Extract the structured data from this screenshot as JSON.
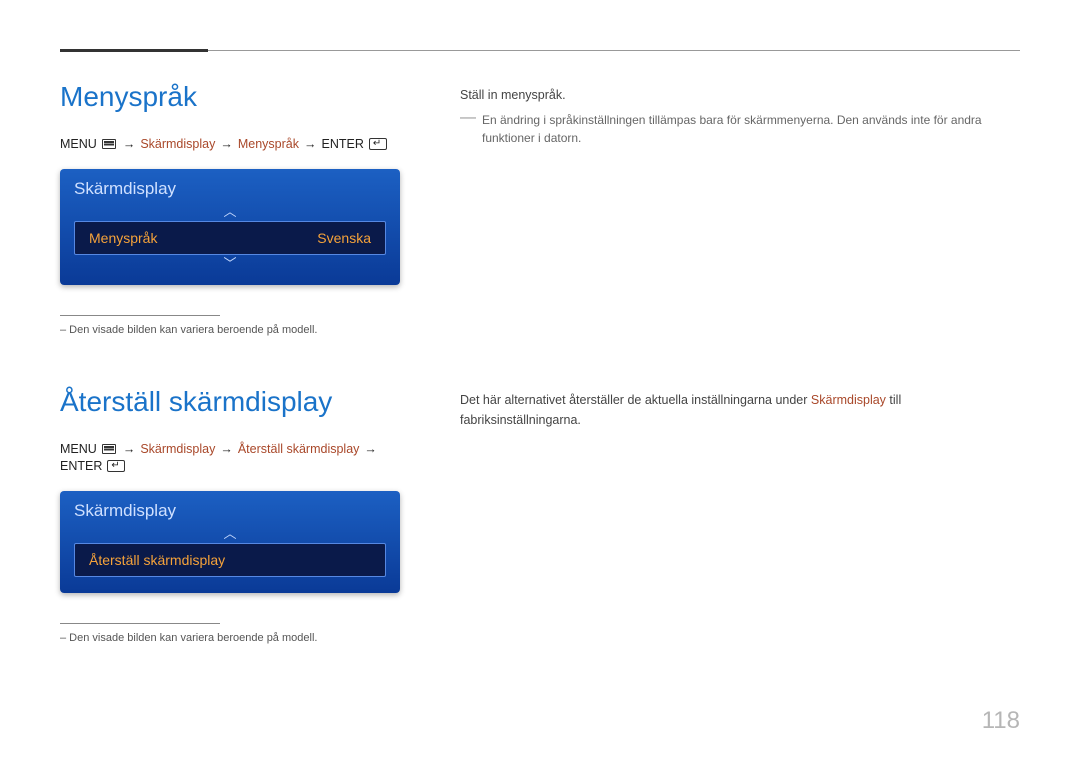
{
  "page_number": "118",
  "section1": {
    "title": "Menyspråk",
    "breadcrumb": {
      "menu": "MENU",
      "p1": "Skärmdisplay",
      "p2": "Menyspråk",
      "enter": "ENTER"
    },
    "menu": {
      "header": "Skärmdisplay",
      "item_label": "Menyspråk",
      "item_value": "Svenska"
    },
    "footnote": "– Den visade bilden kan variera beroende på modell.",
    "desc_intro": "Ställ in menyspråk.",
    "desc_note": "En ändring i språkinställningen tillämpas bara för skärmmenyerna. Den används inte för andra funktioner i datorn."
  },
  "section2": {
    "title": "Återställ skärmdisplay",
    "breadcrumb": {
      "menu": "MENU",
      "p1": "Skärmdisplay",
      "p2": "Återställ skärmdisplay",
      "enter": "ENTER"
    },
    "menu": {
      "header": "Skärmdisplay",
      "item_label": "Återställ skärmdisplay"
    },
    "footnote": "– Den visade bilden kan variera beroende på modell.",
    "desc_pre": "Det här alternativet återställer de aktuella inställningarna under ",
    "desc_hl": "Skärmdisplay",
    "desc_post": " till fabriksinställningarna."
  }
}
